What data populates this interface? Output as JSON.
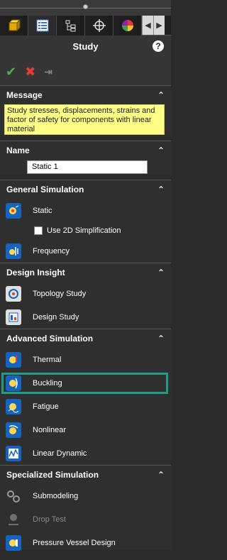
{
  "tabs": [
    {
      "icon": "part-icon"
    },
    {
      "icon": "property-manager-icon"
    },
    {
      "icon": "configuration-icon"
    },
    {
      "icon": "dimxpert-icon"
    },
    {
      "icon": "appearance-icon"
    }
  ],
  "header": {
    "title": "Study",
    "help": "?"
  },
  "actions": {
    "ok": "✔",
    "cancel": "✖",
    "pin": "⇥"
  },
  "message": {
    "title": "Message",
    "text": "Study stresses, displacements, strains and factor of safety  for components with linear material"
  },
  "name": {
    "title": "Name",
    "value": "Static 1"
  },
  "general": {
    "title": "General Simulation",
    "static": "Static",
    "use2d": "Use 2D Simplification",
    "frequency": "Frequency"
  },
  "design": {
    "title": "Design Insight",
    "topology": "Topology Study",
    "design_study": "Design Study"
  },
  "advanced": {
    "title": "Advanced Simulation",
    "thermal": "Thermal",
    "buckling": "Buckling",
    "fatigue": "Fatigue",
    "nonlinear": "Nonlinear",
    "linear_dynamic": "Linear Dynamic"
  },
  "specialized": {
    "title": "Specialized Simulation",
    "submodeling": "Submodeling",
    "drop_test": "Drop Test",
    "pressure_vessel": "Pressure Vessel Design"
  },
  "colors": {
    "highlight": "#1f9d86",
    "message_bg": "#ffff88"
  }
}
